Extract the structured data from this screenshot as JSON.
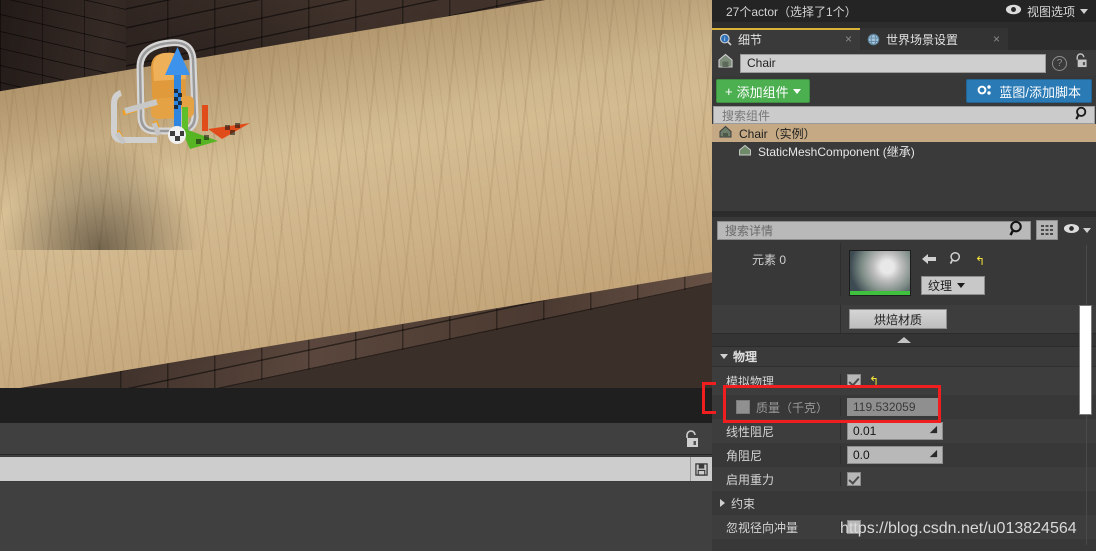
{
  "viewport": {
    "scene_objects": [
      "brick-wall",
      "wooden-floor",
      "orange-chair",
      "transform-gizmo"
    ]
  },
  "right_panel": {
    "actor_bar": {
      "status": "27个actor（选择了1个）",
      "view_options_label": "视图选项",
      "eye_icon": "eye-icon",
      "chevron_icon": "chevron-down-icon"
    },
    "tabs": [
      {
        "label": "细节",
        "icon": "details-magnifier-icon",
        "close": "×",
        "active": true
      },
      {
        "label": "世界场景设置",
        "icon": "world-globe-icon",
        "close": "×",
        "active": false
      }
    ],
    "name_row": {
      "icon": "actor-house-icon",
      "value": "Chair",
      "placeholder": "Chair",
      "help_icon": "?",
      "lock_icon": "lock-open-icon"
    },
    "buttons": {
      "add_component": "添加组件",
      "add_component_plus": "+",
      "add_component_chevron": "chevron-down-icon",
      "blueprint": "蓝图/添加脚本",
      "blueprint_icon": "blueprint-gear-icon"
    },
    "component_search": {
      "placeholder": "搜索组件",
      "icon": "search-icon"
    },
    "component_tree": [
      {
        "label": "Chair（实例）",
        "icon": "actor-house-icon",
        "selected": true,
        "child": false
      },
      {
        "label": "StaticMeshComponent (继承)",
        "icon": "mesh-house-icon",
        "selected": false,
        "child": true
      }
    ],
    "details_search": {
      "placeholder": "搜索详情",
      "icon": "search-icon",
      "grid_icon": "grid-view-icon",
      "eye_icon": "eye-icon",
      "chevron_icon": "chevron-down-icon"
    },
    "material_section": {
      "element_label": "元素 0",
      "thumbnail": "material-sphere-thumbnail",
      "browse_back_icon": "arrow-left-icon",
      "browse_find_icon": "search-icon",
      "reset_icon": "reset-arrow-icon",
      "dropdown_label": "纹理",
      "dropdown_chevron": "chevron-down-icon",
      "bake_button": "烘焙材质",
      "collapse_icon": "collapse-up-icon"
    },
    "physics_section": {
      "title": "物理",
      "expand_icon": "triangle-down-icon",
      "rows": [
        {
          "label": "模拟物理",
          "type": "checkbox",
          "checked": true,
          "reset": "reset-arrow-icon"
        },
        {
          "label": "质量（千克）",
          "type": "text",
          "value": "119.532059",
          "disabled": true,
          "has_checkbox": true
        },
        {
          "label": "线性阻尼",
          "type": "number",
          "value": "0.01",
          "drag_icon": "drag-handle-icon"
        },
        {
          "label": "角阻尼",
          "type": "number",
          "value": "0.0",
          "drag_icon": "drag-handle-icon"
        },
        {
          "label": "启用重力",
          "type": "checkbox",
          "checked": true
        },
        {
          "label": "约束",
          "type": "group",
          "expand_icon": "triangle-right-icon"
        },
        {
          "label": "忽视径向冲量",
          "type": "checkbox",
          "checked": false
        }
      ]
    },
    "scrollbar": "details-vertical-scrollbar"
  },
  "lower_left": {
    "lock_icon": "lock-open-icon",
    "search": {
      "placeholder": "",
      "value": "",
      "icon": "search-icon"
    },
    "save_icon": "save-disk-icon"
  },
  "watermark": "https://blog.csdn.net/u013824564",
  "colors": {
    "accent_yellow": "#d8b337",
    "green_button": "#4caf50",
    "blue_button": "#2a7ab5",
    "selection_tan": "#c4a984",
    "annotation_red": "#f01e1e",
    "panel_bg": "#383838"
  }
}
